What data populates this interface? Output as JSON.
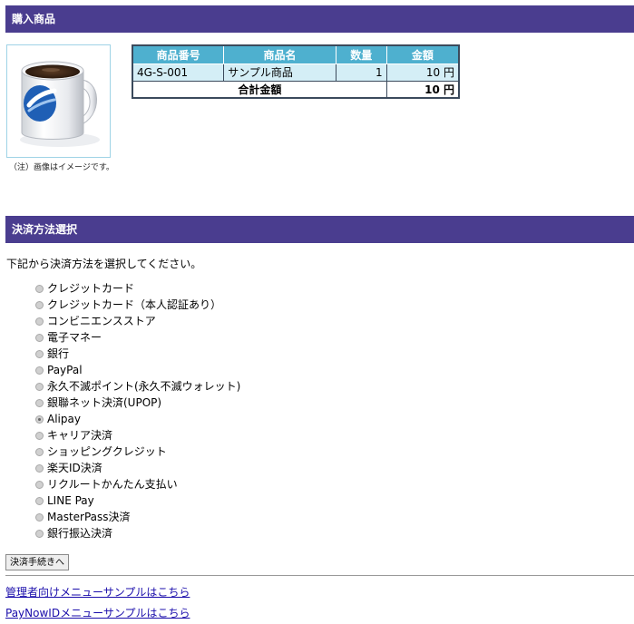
{
  "purchase_section": {
    "header": "購入商品",
    "image_note": "（注）画像はイメージです。"
  },
  "order_table": {
    "headers": [
      "商品番号",
      "商品名",
      "数量",
      "金額"
    ],
    "items": [
      {
        "code": "4G-S-001",
        "name": "サンプル商品",
        "quantity": "1",
        "amount": "10 円"
      }
    ],
    "total_label": "合計金額",
    "total_amount": "10 円"
  },
  "payment_section": {
    "header": "決済方法選択",
    "instruction": "下記から決済方法を選択してください。",
    "methods": [
      "クレジットカード",
      "クレジットカード（本人認証あり）",
      "コンビニエンスストア",
      "電子マネー",
      "銀行",
      "PayPal",
      "永久不滅ポイント(永久不滅ウォレット)",
      "銀聯ネット決済(UPOP)",
      "Alipay",
      "キャリア決済",
      "ショッピングクレジット",
      "楽天ID決済",
      "リクルートかんたん支払い",
      "LINE Pay",
      "MasterPass決済",
      "銀行振込決済"
    ],
    "selected_index": 8,
    "submit_label": "決済手続きへ"
  },
  "footer_links": {
    "admin_menu": "管理者向けメニューサンプルはこちら",
    "paynowid_menu": "PayNowIDメニューサンプルはこちら"
  },
  "colors": {
    "header_bg": "#4a3d8f",
    "table_header_bg": "#4eb0cf",
    "table_row_bg": "#d4eef6",
    "link": "#1a0dab"
  }
}
